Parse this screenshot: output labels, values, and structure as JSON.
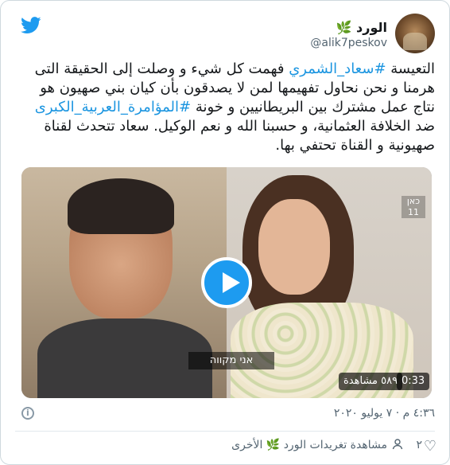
{
  "header": {
    "display_name": "الورد 🌿",
    "handle": "@alik7peskov"
  },
  "tweet": {
    "parts": [
      "التعيسة ",
      "#سعاد_الشمري",
      " فهمت كل شيء و وصلت إلى الحقيقة التى هرمنا و نحن نحاول تفهيمها لمن لا يصدقون بأن كيان بني صهيون هو نتاج عمل مشترك بين البريطانيين و خونة ",
      "#المؤامرة_العربية_الكبرى",
      " ضد الخلافة العثمانية، و حسبنا الله و نعم الوكيل. سعاد تتحدث لقناة صهيونية و القناة تحتفي بها."
    ]
  },
  "media": {
    "channel_logo": "כאן 11",
    "subtitle": "אני מקווה",
    "views": "٥٨٩ مشاهدة",
    "duration": "0:33"
  },
  "footer": {
    "timestamp": "٤:٣٦ م · ٧ يوليو ٢٠٢٠"
  },
  "actions": {
    "likes": "٢",
    "see_more": "مشاهدة تغريدات الورد 🌿 الأخرى"
  },
  "colors": {
    "accent": "#1d9bf0",
    "hashtag": "#1b95e0",
    "muted": "#536471"
  }
}
